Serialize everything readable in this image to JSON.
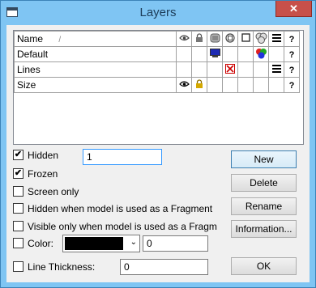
{
  "window": {
    "title": "Layers",
    "close_glyph": "✕"
  },
  "grid": {
    "header": {
      "name": "Name",
      "sort_glyph": "/",
      "col_help": "?"
    },
    "rows": [
      {
        "name": "Default",
        "help": "?"
      },
      {
        "name": "Lines",
        "help": "?"
      },
      {
        "name": "Size",
        "help": "?"
      }
    ]
  },
  "options": {
    "hidden": {
      "label": "Hidden",
      "checked": true,
      "check_glyph": "✔",
      "value": "1"
    },
    "frozen": {
      "label": "Frozen",
      "checked": true,
      "check_glyph": "✔"
    },
    "screen_only": {
      "label": "Screen only",
      "checked": false
    },
    "hidden_fragment": {
      "label": "Hidden when model is used as a Fragment",
      "checked": false
    },
    "visible_fragment": {
      "label": "Visible only when model is used as a Fragm",
      "checked": false
    },
    "color": {
      "label": "Color:",
      "checked": false,
      "value": "0",
      "swatch": "#000000",
      "arrow_glyph": "⌄"
    },
    "line_thickness": {
      "label": "Line Thickness:",
      "checked": false,
      "value": "0"
    }
  },
  "buttons": {
    "new": "New",
    "delete": "Delete",
    "rename": "Rename",
    "information": "Information...",
    "ok": "OK"
  },
  "colors": {
    "accent": "#7fc5f3",
    "close": "#c7504a"
  }
}
